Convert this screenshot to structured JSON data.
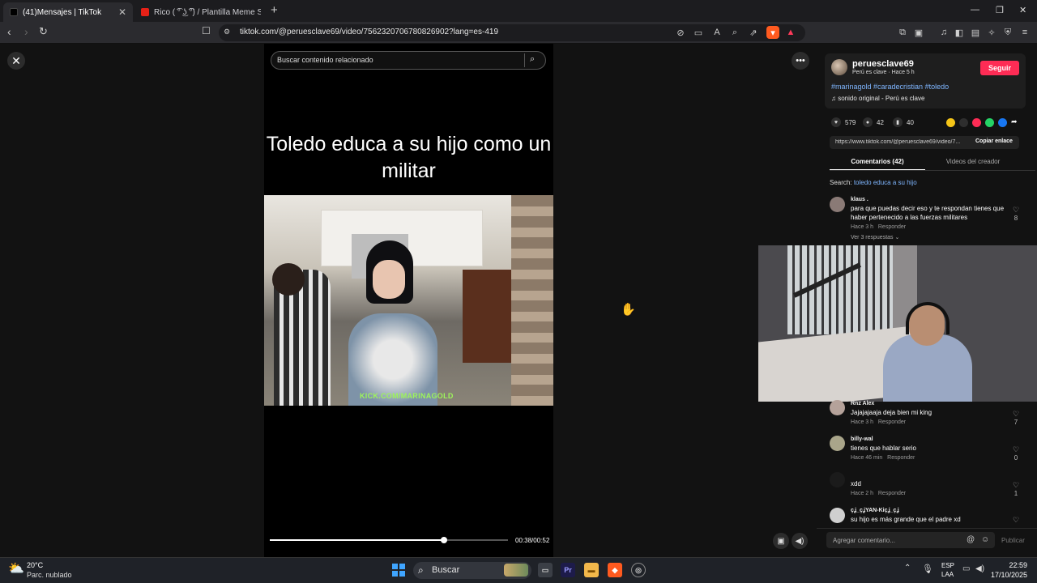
{
  "browser": {
    "tabs": [
      {
        "title": "(41)Mensajes | TikTok",
        "active": true,
        "icon": "tiktok-icon"
      },
      {
        "title": "Rico ( ͡° ͜ʖ ͡°) / Plantilla Meme South P",
        "active": false,
        "icon": "youtube-icon"
      }
    ],
    "url": "tiktok.com/@peruesclave69/video/7562320706780826902?lang=es-419"
  },
  "video": {
    "search_placeholder": "Buscar contenido relacionado",
    "caption": "Toledo educa a su hijo como un militar",
    "watermark": "KICK.COM/MARINAGOLD",
    "progress_fraction": 0.73,
    "time": "00:38/00:52"
  },
  "creator": {
    "username": "peruesclave69",
    "subtitle": "Perú es clave · Hace 5 h",
    "follow_label": "Seguir",
    "hashtags": "#marinagold #caradecristian #toledo",
    "sound": "sonido original - Perú es clave",
    "likes": "579",
    "comments": "42",
    "saves": "40",
    "link": "https://www.tiktok.com/@peruesclave69/video/7...",
    "copy_label": "Copiar enlace",
    "accent": "#fe2c55"
  },
  "tabs": {
    "comments": "Comentarios (42)",
    "creator_videos": "Videos del creador"
  },
  "search_hint": {
    "prefix": "Search:",
    "query": "toledo educa a su hijo"
  },
  "comments": [
    {
      "name": "klaus .",
      "text": "para que puedas decir eso y te respondan tienes que haber pertenecido a las fuerzas militares",
      "time": "Hace 3 h",
      "reply": "Responder",
      "likes": "8",
      "replies": "Ver 3 respuestas ⌄"
    },
    {
      "name": "Rnz Alex",
      "text": "Jajajajaaja deja bien mi king",
      "time": "Hace 3 h",
      "reply": "Responder",
      "likes": "7"
    },
    {
      "name": "billy-wal",
      "text": "tienes que hablar serio",
      "time": "Hace 46 min",
      "reply": "Responder",
      "likes": "0"
    },
    {
      "name": "",
      "text": "xdd",
      "time": "Hace 2 h",
      "reply": "Responder",
      "likes": "1"
    },
    {
      "name": "çʝ_çʝYAN-Kiçʝ_çʝ",
      "text": "su hijo es más grande que el padre xd",
      "time": "",
      "reply": "",
      "likes": ""
    }
  ],
  "comment_input": {
    "placeholder": "Agregar comentario...",
    "publish": "Publicar"
  },
  "taskbar": {
    "temperature": "20°C",
    "condition": "Parc. nublado",
    "search": "Buscar",
    "lang1": "ESP",
    "lang2": "LAA",
    "time": "22:59",
    "date": "17/10/2025"
  }
}
